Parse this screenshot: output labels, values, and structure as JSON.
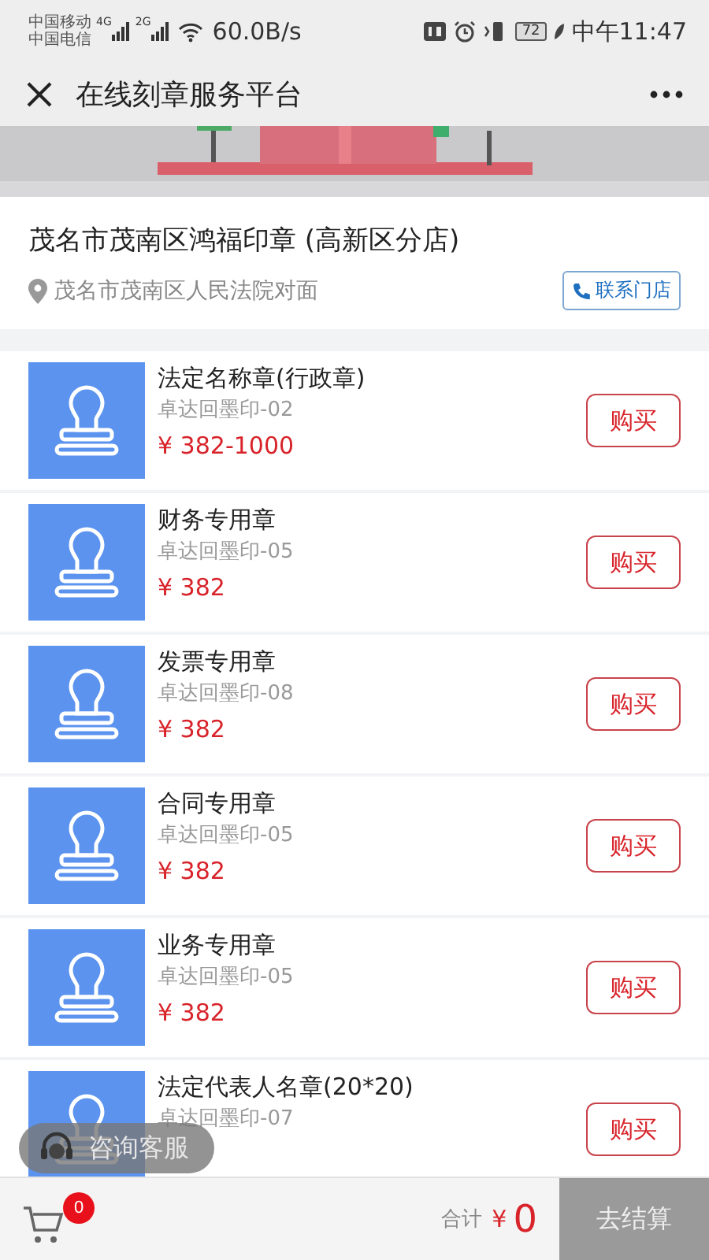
{
  "status_bar": {
    "carriers": [
      "中国移动",
      "中国电信"
    ],
    "networks": [
      "4G",
      "2G"
    ],
    "speed": "60.0B/s",
    "battery": "72",
    "time": "中午11:47"
  },
  "header": {
    "title": "在线刻章服务平台"
  },
  "store": {
    "name": "茂名市茂南区鸿福印章 (高新区分店)",
    "address": "茂名市茂南区人民法院对面",
    "contact": "联系门店"
  },
  "products": [
    {
      "name": "法定名称章(行政章)",
      "code": "卓达回墨印-02",
      "price": "¥ 382-1000",
      "buy": "购买"
    },
    {
      "name": "财务专用章",
      "code": "卓达回墨印-05",
      "price": "¥ 382",
      "buy": "购买"
    },
    {
      "name": "发票专用章",
      "code": "卓达回墨印-08",
      "price": "¥ 382",
      "buy": "购买"
    },
    {
      "name": "合同专用章",
      "code": "卓达回墨印-05",
      "price": "¥ 382",
      "buy": "购买"
    },
    {
      "name": "业务专用章",
      "code": "卓达回墨印-05",
      "price": "¥ 382",
      "buy": "购买"
    },
    {
      "name": "法定代表人名章(20*20)",
      "code": "卓达回墨印-07",
      "buy": "购买"
    }
  ],
  "consult": {
    "label": "咨询客服"
  },
  "cart_bar": {
    "count": "0",
    "total_label": "合计",
    "currency": "¥",
    "total": "0",
    "checkout": "去结算"
  }
}
